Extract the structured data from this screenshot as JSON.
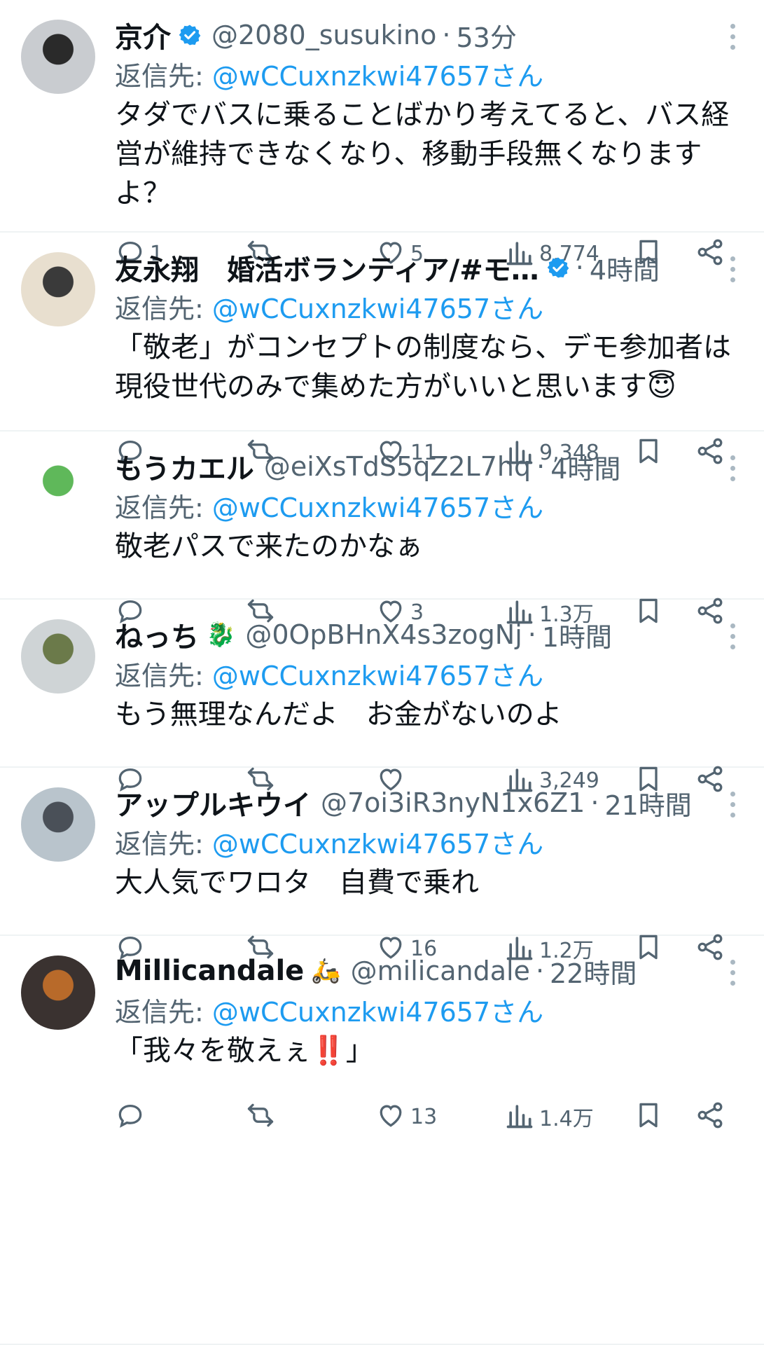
{
  "reply_prefix": "返信先: ",
  "tweets": [
    {
      "name": "京介",
      "verified": true,
      "handle": "@2080_susukino",
      "dot": "·",
      "time": "53分",
      "reply_to": "@wCCuxnzkwi47657さん",
      "text": "タダでバスに乗ることばかり考えてると、バス経営が維持できなくなり、移動手段無くなりますよ？",
      "replies": "1",
      "retweets": "",
      "likes": "5",
      "views": "8,774",
      "avatar_colors": [
        "#c9ccd0",
        "#2a2a2a"
      ]
    },
    {
      "name": "友永翔　婚活ボランティア/#モ…",
      "verified": true,
      "handle": "",
      "dot": "·",
      "time": "4時間",
      "reply_to": "@wCCuxnzkwi47657さん",
      "text": "「敬老」がコンセプトの制度なら、デモ参加者は現役世代のみで集めた方がいいと思います😇",
      "replies": "",
      "retweets": "",
      "likes": "11",
      "views": "9,348",
      "avatar_colors": [
        "#e8dfcf",
        "#3a3a3a"
      ]
    },
    {
      "name": "もうカエル",
      "verified": false,
      "handle": "@eiXsTdS5qZ2L7hq",
      "dot": "·",
      "time": "4時間",
      "reply_to": "@wCCuxnzkwi47657さん",
      "text": "敬老パスで来たのかなぁ",
      "replies": "",
      "retweets": "",
      "likes": "3",
      "views": "1.3万",
      "avatar_colors": [
        "#ffffff",
        "#5fb85a"
      ]
    },
    {
      "name": "ねっち",
      "verified": false,
      "mark": "🐉",
      "handle": "@0OpBHnX4s3zogNj",
      "dot": "·",
      "time": "1時間",
      "reply_to": "@wCCuxnzkwi47657さん",
      "text": "もう無理なんだよ　お金がないのよ",
      "replies": "",
      "retweets": "",
      "likes": "",
      "views": "3,249",
      "avatar_colors": [
        "#cfd4d6",
        "#6b7a4a"
      ]
    },
    {
      "name": "アップルキウイ",
      "verified": false,
      "handle": "@7oi3iR3nyN1x6Z1",
      "dot": "·",
      "time": "21時間",
      "reply_to": "@wCCuxnzkwi47657さん",
      "text": "大人気でワロタ　自費で乗れ",
      "replies": "",
      "retweets": "",
      "likes": "16",
      "views": "1.2万",
      "avatar_colors": [
        "#b9c4cc",
        "#4a5058"
      ]
    },
    {
      "name": "Millicandale",
      "verified": false,
      "mark": "🛵",
      "handle": "@milicandale",
      "dot": "·",
      "time": "22時間",
      "reply_to": "@wCCuxnzkwi47657さん",
      "text": "「我々を敬えぇ‼️」",
      "replies": "",
      "retweets": "",
      "likes": "13",
      "views": "1.4万",
      "avatar_colors": [
        "#3a3230",
        "#b86a2a"
      ]
    }
  ],
  "colors": {
    "text": "#0f1419",
    "secondary": "#536471",
    "link": "#1d9bf0",
    "verified": "#1d9bf0",
    "divider": "#eff3f4"
  },
  "icons": [
    "verified-badge-icon",
    "more-icon",
    "reply-icon",
    "retweet-icon",
    "like-icon",
    "views-icon",
    "bookmark-icon",
    "share-icon"
  ]
}
